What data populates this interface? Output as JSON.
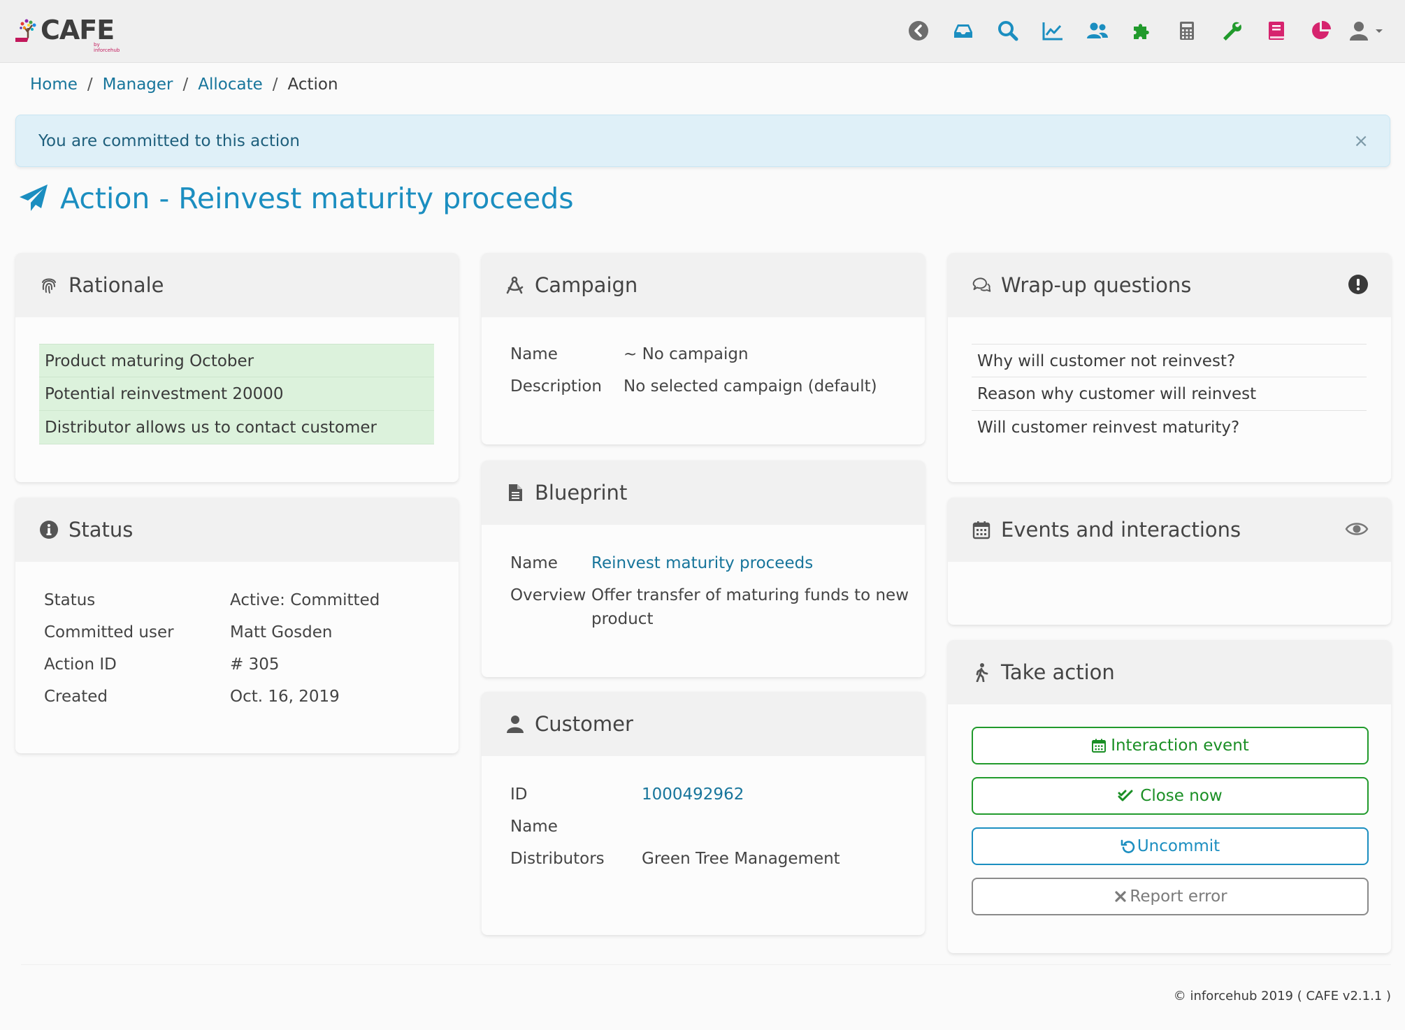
{
  "app": {
    "logo_text": "CAFE",
    "logo_sub": "by inforcehub"
  },
  "nav": {
    "icons": [
      "back-icon",
      "inbox-icon",
      "search-icon",
      "chart-line-icon",
      "users-icon",
      "puzzle-icon",
      "calculator-icon",
      "wrench-icon",
      "book-icon",
      "pie-chart-icon",
      "user-icon"
    ]
  },
  "breadcrumb": {
    "home": "Home",
    "sep": "/",
    "manager": "Manager",
    "allocate": "Allocate",
    "current": "Action"
  },
  "alert": {
    "text": "You are committed to this action",
    "close": "×"
  },
  "page": {
    "title": "Action - Reinvest maturity proceeds"
  },
  "rationale": {
    "title": "Rationale",
    "items": [
      "Product maturing October",
      "Potential reinvestment 20000",
      "Distributor allows us to contact customer"
    ]
  },
  "status": {
    "title": "Status",
    "rows": [
      {
        "label": "Status",
        "value": "Active: Committed"
      },
      {
        "label": "Committed user",
        "value": "Matt Gosden"
      },
      {
        "label": "Action ID",
        "value": "# 305"
      },
      {
        "label": "Created",
        "value": "Oct. 16, 2019"
      }
    ]
  },
  "campaign": {
    "title": "Campaign",
    "name_label": "Name",
    "name_value": "~ No campaign",
    "description_label": "Description",
    "description_value": "No selected campaign (default)"
  },
  "blueprint": {
    "title": "Blueprint",
    "name_label": "Name",
    "name_value": "Reinvest maturity proceeds",
    "overview_label": "Overview",
    "overview_line1": "Offer transfer of maturing funds to new",
    "overview_line2": "product"
  },
  "customer": {
    "title": "Customer",
    "id_label": "ID",
    "id_value": "1000492962",
    "name_label": "Name",
    "name_value": "",
    "distributors_label": "Distributors",
    "distributors_value": "Green Tree Management"
  },
  "wrapup": {
    "title": "Wrap-up questions",
    "items": [
      "Why will customer not reinvest?",
      "Reason why customer will reinvest",
      "Will customer reinvest maturity?"
    ]
  },
  "events": {
    "title": "Events and interactions"
  },
  "take_action": {
    "title": "Take action",
    "interaction_label": "Interaction event",
    "close_label": "Close now",
    "uncommit_label": "Uncommit",
    "report_label": "Report error"
  },
  "footer": {
    "text": "© inforcehub 2019 ( CAFE v2.1.1 )"
  },
  "colors": {
    "primary": "#1b8ec0",
    "link": "#17759b",
    "success": "#219a2c",
    "alert_bg": "#dff0f8",
    "rationale_bg": "#dcf2dc",
    "brand_pink": "#d6246e"
  }
}
